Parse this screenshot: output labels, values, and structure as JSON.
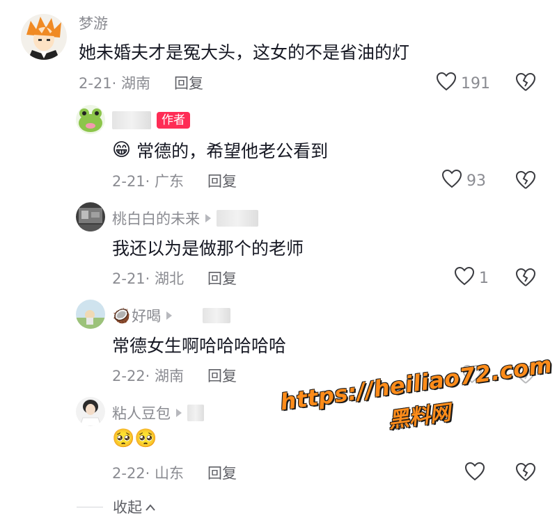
{
  "comments": [
    {
      "username": "梦游",
      "text": "她未婚夫才是冤大头，这女的不是省油的灯",
      "date_location": "2-21· 湖南",
      "reply_label": "回复",
      "likes": "191"
    },
    {
      "author_badge": "作者",
      "emoji": "😁",
      "text": "常德的，希望他老公看到",
      "date_location": "2-21· 广东",
      "reply_label": "回复",
      "likes": "93"
    },
    {
      "username": "桃白白的未来",
      "text": "我还以为是做那个的老师",
      "date_location": "2-21· 湖北",
      "reply_label": "回复",
      "likes": "1"
    },
    {
      "username_emoji": "🥥",
      "username": "好喝",
      "text": "常德女生啊哈哈哈哈哈",
      "date_location": "2-22· 湖南",
      "reply_label": "回复",
      "likes": ""
    },
    {
      "username": "粘人豆包",
      "emoji": "🥺🥺",
      "date_location": "2-22· 山东",
      "reply_label": "回复",
      "likes": ""
    }
  ],
  "collapse_label": "收起",
  "watermark": {
    "url": "https://heiliao72.com",
    "cn": "黑料网"
  },
  "colors": {
    "text": "#161823",
    "meta": "#8a8b91",
    "author_badge": "#fe2c55",
    "watermark": "#ff8c1a"
  }
}
